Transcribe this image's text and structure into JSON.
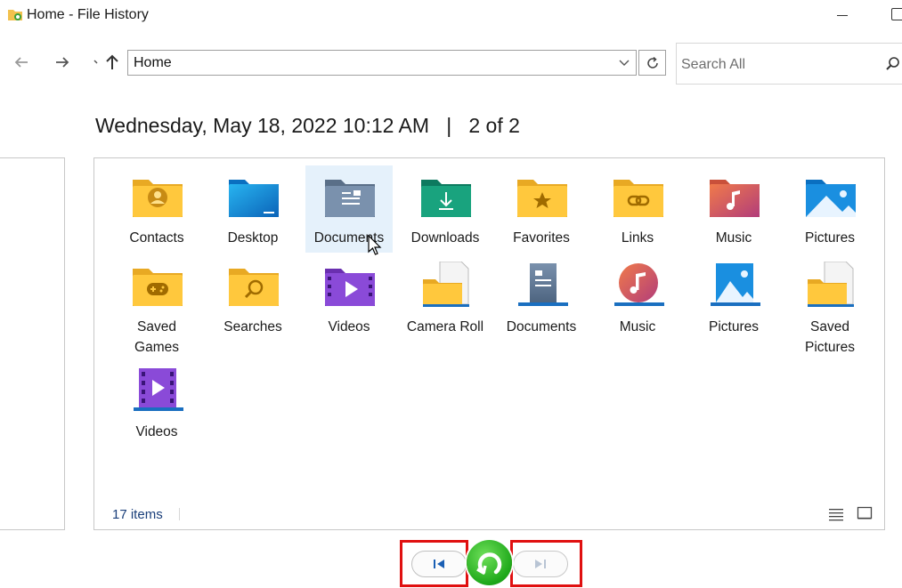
{
  "window": {
    "title": "Home - File History"
  },
  "navigation": {
    "address": "Home",
    "search_placeholder": "Search All"
  },
  "snapshot": {
    "heading": "Wednesday, May 18, 2022 10:12 AM   |   2 of 2"
  },
  "items": [
    {
      "label": "Contacts",
      "icon": "contacts-folder-icon"
    },
    {
      "label": "Desktop",
      "icon": "desktop-folder-icon"
    },
    {
      "label": "Documents",
      "icon": "documents-folder-icon",
      "selected": true
    },
    {
      "label": "Downloads",
      "icon": "downloads-folder-icon"
    },
    {
      "label": "Favorites",
      "icon": "favorites-folder-icon"
    },
    {
      "label": "Links",
      "icon": "links-folder-icon"
    },
    {
      "label": "Music",
      "icon": "music-folder-icon"
    },
    {
      "label": "Pictures",
      "icon": "pictures-folder-icon"
    },
    {
      "label": "Saved Games",
      "icon": "saved-games-folder-icon"
    },
    {
      "label": "Searches",
      "icon": "searches-folder-icon"
    },
    {
      "label": "Videos",
      "icon": "videos-folder-icon"
    },
    {
      "label": "Camera Roll",
      "icon": "camera-roll-folder-icon"
    },
    {
      "label": "Documents",
      "icon": "documents-library-icon"
    },
    {
      "label": "Music",
      "icon": "music-library-icon"
    },
    {
      "label": "Pictures",
      "icon": "pictures-library-icon"
    },
    {
      "label": "Saved Pictures",
      "icon": "saved-pictures-folder-icon"
    },
    {
      "label": "Videos",
      "icon": "videos-library-icon"
    }
  ],
  "status": {
    "count": "17 items"
  },
  "colors": {
    "accent": "#1ea81a",
    "highlight": "#e01010",
    "selection": "#e5f1fb"
  }
}
